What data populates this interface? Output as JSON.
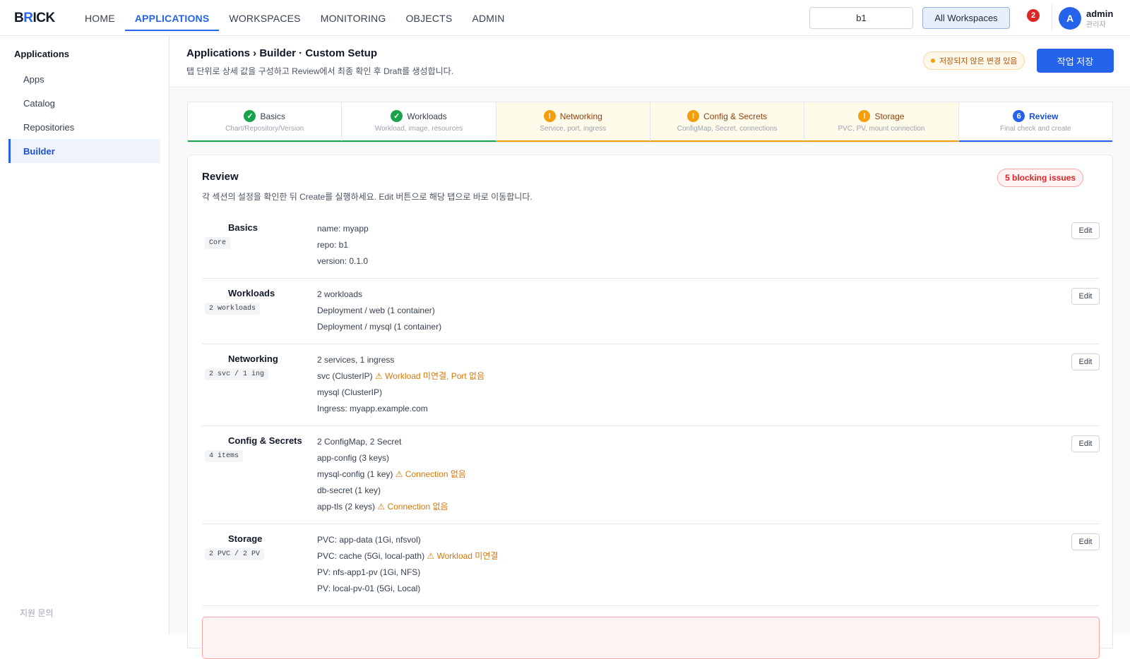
{
  "app": {
    "logo_pre": "B",
    "logo_accent": "R",
    "logo_post": "ICK"
  },
  "nav": {
    "items": [
      "HOME",
      "APPLICATIONS",
      "WORKSPACES",
      "MONITORING",
      "OBJECTS",
      "ADMIN"
    ],
    "active": "APPLICATIONS"
  },
  "topbar": {
    "repo_value": "b1",
    "workspace_label": "All Workspaces",
    "notification_count": "2",
    "user_initial": "A",
    "user_name": "admin",
    "user_role": "관리자"
  },
  "sidebar": {
    "title": "Applications",
    "items": [
      {
        "label": "Apps"
      },
      {
        "label": "Catalog"
      },
      {
        "label": "Repositories"
      },
      {
        "label": "Builder"
      }
    ],
    "active": "Builder",
    "footer": "지원 문의"
  },
  "header": {
    "breadcrumb": "Applications › Builder · Custom Setup",
    "subtitle": "탭 단위로 상세 값을 구성하고 Review에서 최종 확인 후 Draft를 생성합니다.",
    "unsaved_label": "저장되지 않은 변경 있음",
    "save_label": "작업 저장"
  },
  "tabs": [
    {
      "label": "Basics",
      "sub": "Chart/Repository/Version",
      "state": "done",
      "icon": "✓"
    },
    {
      "label": "Workloads",
      "sub": "Workload, image, resources",
      "state": "done",
      "icon": "✓"
    },
    {
      "label": "Networking",
      "sub": "Service, port, ingress",
      "state": "warn",
      "icon": "!"
    },
    {
      "label": "Config & Secrets",
      "sub": "ConfigMap, Secret, connections",
      "state": "warn",
      "icon": "!"
    },
    {
      "label": "Storage",
      "sub": "PVC, PV, mount connection",
      "state": "warn",
      "icon": "!"
    },
    {
      "label": "Review",
      "sub": "Final check and create",
      "state": "current",
      "icon": "6"
    }
  ],
  "review": {
    "title": "Review",
    "description": "각 섹션의 설정을 확인한 뒤 Create를 실행하세요. Edit 버튼으로 해당 탭으로 바로 이동합니다.",
    "blocking_label": "5 blocking issues",
    "edit_label": "Edit",
    "sections": [
      {
        "name": "Basics",
        "tag": "Core",
        "lines": [
          {
            "text": "name: myapp"
          },
          {
            "text": "repo: b1"
          },
          {
            "text": "version: 0.1.0"
          }
        ]
      },
      {
        "name": "Workloads",
        "tag": "2 workloads",
        "lines": [
          {
            "text": "2 workloads"
          },
          {
            "text": "Deployment / web (1 container)"
          },
          {
            "text": "Deployment / mysql (1 container)"
          }
        ]
      },
      {
        "name": "Networking",
        "tag": "2 svc / 1 ing",
        "lines": [
          {
            "text": "2 services, 1 ingress"
          },
          {
            "text": "svc (ClusterIP)",
            "warn": "⚠ Workload 미연결, Port 없음"
          },
          {
            "text": "mysql (ClusterIP)"
          },
          {
            "text": "Ingress: myapp.example.com"
          }
        ]
      },
      {
        "name": "Config & Secrets",
        "tag": "4 items",
        "lines": [
          {
            "text": "2 ConfigMap, 2 Secret"
          },
          {
            "text": "app-config (3 keys)"
          },
          {
            "text": "mysql-config (1 key)",
            "warn": "⚠ Connection 없음"
          },
          {
            "text": "db-secret (1 key)"
          },
          {
            "text": "app-tls (2 keys)",
            "warn": "⚠ Connection 없음"
          }
        ]
      },
      {
        "name": "Storage",
        "tag": "2 PVC / 2 PV",
        "lines": [
          {
            "text": "PVC: app-data (1Gi, nfsvol)"
          },
          {
            "text": "PVC: cache (5Gi, local-path)",
            "warn": "⚠ Workload 미연결"
          },
          {
            "text": "PV: nfs-app1-pv (1Gi, NFS)"
          },
          {
            "text": "PV: local-pv-01 (5Gi, Local)"
          }
        ]
      }
    ]
  },
  "colors": {
    "accent": "#2563eb",
    "success": "#16a34a",
    "warning": "#f59e0b",
    "danger": "#dc2626"
  }
}
